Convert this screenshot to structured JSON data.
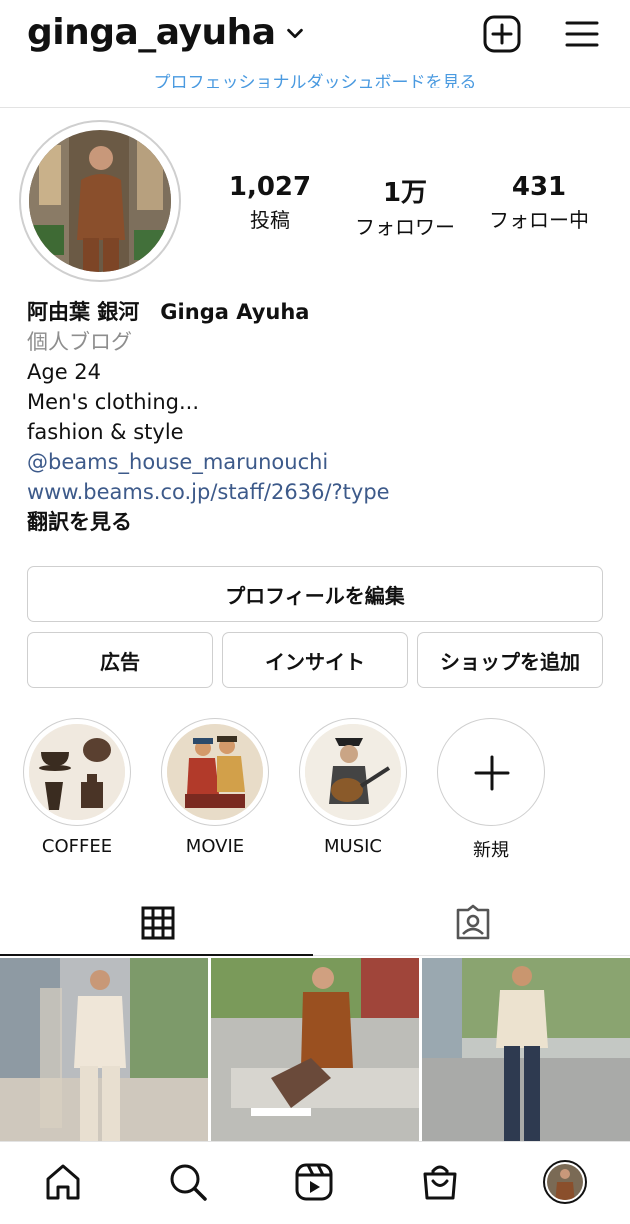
{
  "header": {
    "username": "ginga_ayuha",
    "pro_dashboard_link": "プロフェッショナルダッシュボードを見る"
  },
  "stats": [
    {
      "value": "1,027",
      "label": "投稿"
    },
    {
      "value": "1万",
      "label": "フォロワー"
    },
    {
      "value": "431",
      "label": "フォロー中"
    }
  ],
  "bio": {
    "name": "阿由葉 銀河　Ginga Ayuha",
    "category": "個人ブログ",
    "lines": [
      "Age 24",
      "Men's clothing...",
      "fashion & style"
    ],
    "mention": "@beams_house_marunouchi",
    "website": "www.beams.co.jp/staff/2636/?type",
    "translate": "翻訳を見る"
  },
  "buttons": {
    "edit_profile": "プロフィールを編集",
    "ads": "広告",
    "insights": "インサイト",
    "add_shop": "ショップを追加"
  },
  "highlights": [
    {
      "label": "COFFEE"
    },
    {
      "label": "MOVIE"
    },
    {
      "label": "MUSIC"
    },
    {
      "label": "新規"
    }
  ],
  "colors": {
    "link": "#3d5a8a",
    "pro_link": "#4a9ae0",
    "muted": "#8e8e8e",
    "border": "#cfcfcf"
  },
  "icons": {
    "header": [
      "chevron-down-icon",
      "new-post-icon",
      "menu-icon"
    ],
    "tabs": [
      "grid-icon",
      "tagged-icon"
    ],
    "nav": [
      "home-icon",
      "search-icon",
      "reels-icon",
      "shop-icon",
      "profile-avatar-icon"
    ]
  }
}
